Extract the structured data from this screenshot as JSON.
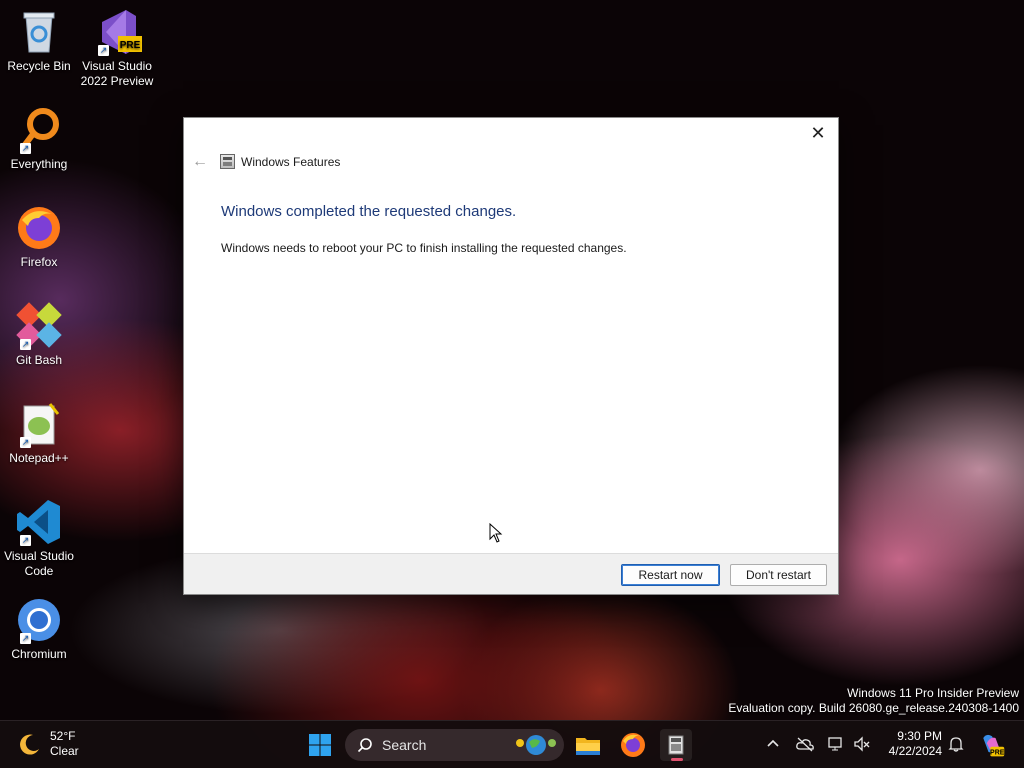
{
  "desktop": {
    "icons": [
      {
        "label": "Recycle Bin",
        "icon": "recycle-bin-icon"
      },
      {
        "label": "Visual Studio 2022 Preview",
        "icon": "visual-studio-preview-icon",
        "badge": "PRE"
      },
      {
        "label": "Everything",
        "icon": "everything-search-icon"
      },
      {
        "label": "Firefox",
        "icon": "firefox-icon"
      },
      {
        "label": "Git Bash",
        "icon": "git-bash-icon"
      },
      {
        "label": "Notepad++",
        "icon": "notepadpp-icon"
      },
      {
        "label": "Visual Studio Code",
        "icon": "vscode-icon"
      },
      {
        "label": "Chromium",
        "icon": "chromium-icon"
      }
    ]
  },
  "dialog": {
    "window_title": "Windows Features",
    "close_glyph": "✕",
    "back_glyph": "←",
    "heading": "Windows completed the requested changes.",
    "message": "Windows needs to reboot your PC to finish installing the requested changes.",
    "restart_label": "Restart now",
    "dont_restart_label": "Don't restart",
    "heading_color": "#1e3a78"
  },
  "watermark": {
    "line1": "Windows 11 Pro Insider Preview",
    "line2": "Evaluation copy. Build 26080.ge_release.240308-1400"
  },
  "taskbar": {
    "weather": {
      "temp": "52°F",
      "condition": "Clear"
    },
    "search_label": "Search",
    "clock": {
      "time": "9:30 PM",
      "date": "4/22/2024"
    },
    "copilot_badge": "PRE",
    "accent_color": "#e0526f"
  }
}
